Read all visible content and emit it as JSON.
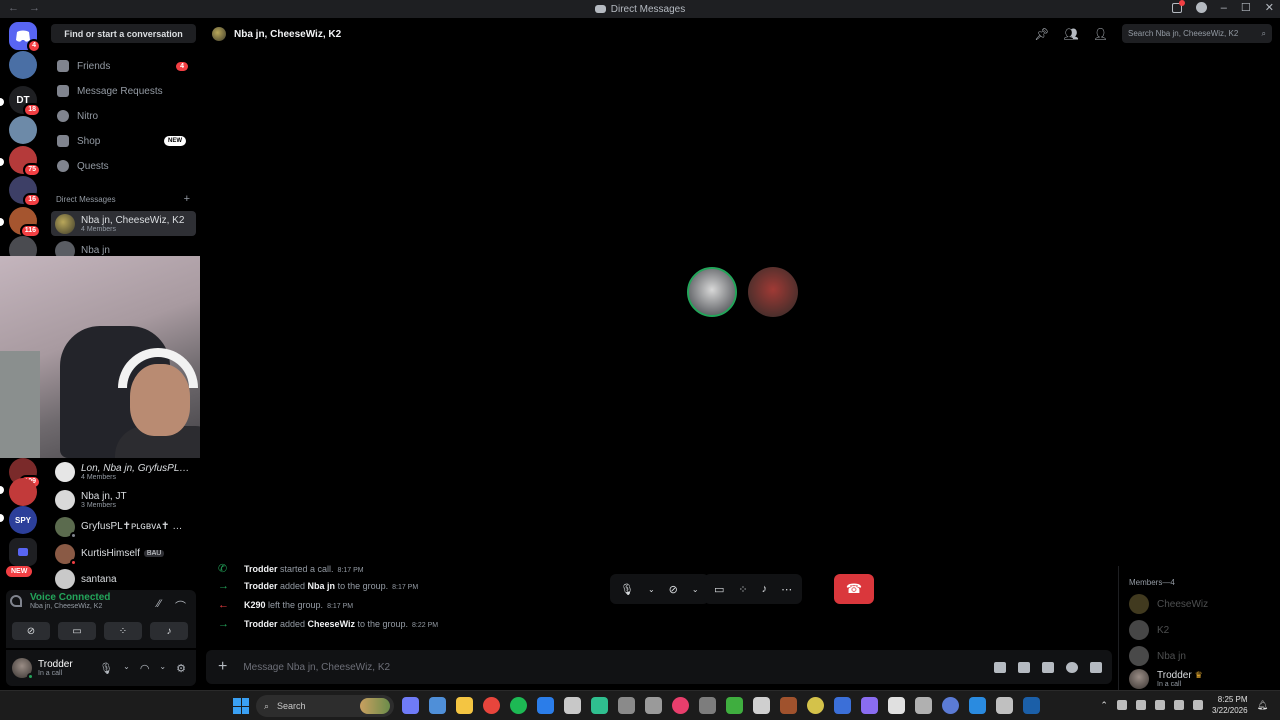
{
  "titlebar": {
    "title": "Direct Messages",
    "back": "←",
    "forward": "→",
    "minimize": "–",
    "maximize": "☐",
    "close": "✕",
    "help": "?"
  },
  "servers": [
    {
      "badge": "4",
      "color": "#5865f2"
    },
    {
      "badge": "",
      "color": "#4a6fa5"
    },
    {
      "badge": "18",
      "color": "#1e1f22",
      "label": "DT"
    },
    {
      "badge": "",
      "color": "#6d8aa8"
    },
    {
      "badge": "75",
      "color": "#b53a3a"
    },
    {
      "badge": "16",
      "color": "#3d3f66"
    },
    {
      "badge": "116",
      "color": "#a5552f"
    },
    {
      "badge": "109",
      "color": "#7a2a2a"
    },
    {
      "badge": "",
      "color": "#c23a3a"
    },
    {
      "badge": "",
      "color": "#2c3f9a",
      "label": "SPY"
    },
    {
      "badge": "",
      "color": "#1e1f22"
    }
  ],
  "rail_new_badge": "NEW",
  "sidebar": {
    "find_button": "Find or start a conversation",
    "nav": [
      {
        "label": "Friends",
        "count": "4"
      },
      {
        "label": "Message Requests"
      },
      {
        "label": "Nitro"
      },
      {
        "label": "Shop",
        "tag": "NEW"
      },
      {
        "label": "Quests"
      }
    ],
    "dm_header": "Direct Messages",
    "dm_add": "+",
    "dms": [
      {
        "name": "Nba jn, CheeseWiz, K2",
        "sub": "4 Members"
      },
      {
        "name": "Nba jn",
        "sub": ""
      },
      {
        "name": "Lon, Nba jn, GryfusPL✝︎…",
        "sub": "4 Members"
      },
      {
        "name": "Nba jn, JT",
        "sub": "3 Members"
      },
      {
        "name": "GryfusPL✝︎ᴘʟɢʙᴠᴀ✝︎ …",
        "sub": ""
      },
      {
        "name": "KurtisHimself",
        "sub": "",
        "tag": "BAU"
      },
      {
        "name": "santana",
        "sub": ""
      }
    ]
  },
  "voice": {
    "title": "Voice Connected",
    "subtitle": "Nba jn, CheeseWiz, K2"
  },
  "user": {
    "name": "Trodder",
    "status": "In a call"
  },
  "channel": {
    "name": "Nba jn, CheeseWiz, K2",
    "search_placeholder": "Search Nba jn, CheeseWiz, K2"
  },
  "chat_log": [
    {
      "arrow": "✆",
      "color": "#23a55a",
      "actor": "Trodder",
      "text1": " started a call.",
      "target": "",
      "text2": "",
      "time": "8:17 PM"
    },
    {
      "arrow": "→",
      "color": "#23a55a",
      "actor": "Trodder",
      "text1": " added ",
      "target": "Nba jn",
      "text2": " to the group.",
      "time": "8:17 PM"
    },
    {
      "arrow": "←",
      "color": "#f23f43",
      "actor": "K290",
      "text1": " left the group.",
      "target": "",
      "text2": "",
      "time": "8:17 PM"
    },
    {
      "arrow": "→",
      "color": "#23a55a",
      "actor": "Trodder",
      "text1": " added ",
      "target": "CheeseWiz",
      "text2": " to the group.",
      "time": "8:22 PM"
    }
  ],
  "composer": {
    "placeholder": "Message Nba jn, CheeseWiz, K2"
  },
  "members": {
    "header": "Members—4",
    "list": [
      {
        "name": "CheeseWiz",
        "status": ""
      },
      {
        "name": "K2",
        "status": ""
      },
      {
        "name": "Nba jn",
        "status": ""
      },
      {
        "name": "Trodder",
        "status": "In a call"
      }
    ]
  },
  "taskbar": {
    "search_label": "Search",
    "time": "8:25 PM",
    "date": "3/22/2026"
  }
}
